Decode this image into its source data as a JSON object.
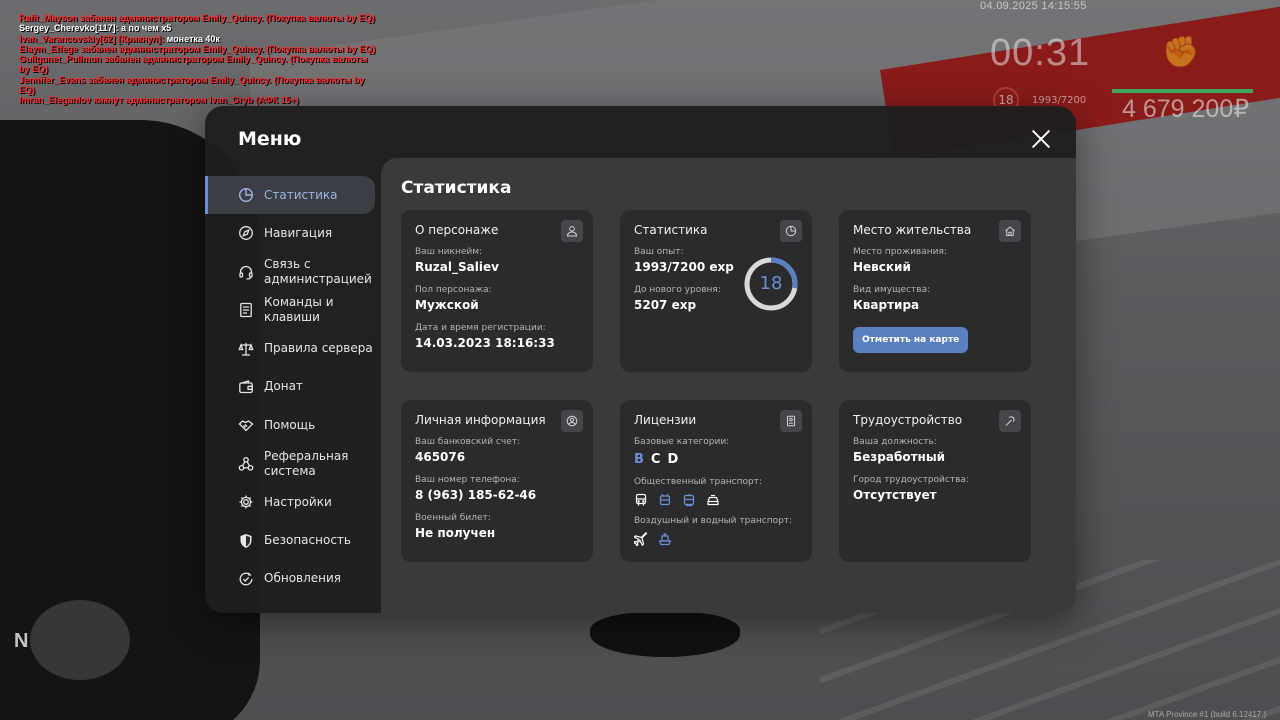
{
  "chat": [
    {
      "text": "Rafit_Mayson забанен администратором Emily_Quincy. (Покупка валюты by EQ)",
      "color": "red"
    },
    {
      "text": "Sergey_Cherevko[117]: а по чем x5",
      "color": "white"
    },
    {
      "text": "Ivan_Varancovskiy[62] [Крикнул]: монетка 40к",
      "color": "mixed"
    },
    {
      "text": "Elaym_Effege забанен администратором Emily_Quincy. (Покупка валюты by EQ)",
      "color": "red"
    },
    {
      "text": "Gullgunet_Pullmun забанен администратором Emily_Quincy. (Покупка валюты by EQ)",
      "color": "red"
    },
    {
      "text": "Jennifer_Evans забанен администратором Emily_Quincy. (Покупка валюты by EQ)",
      "color": "red"
    },
    {
      "text": "Imran_Eleganlov кикнут администратором Ivan_Gryb (АФК 15+)",
      "color": "red"
    }
  ],
  "hud": {
    "datetime": "04.09.2025 14:15:55",
    "timer": "00:31",
    "level": "18",
    "exp": "1993/7200",
    "money": "4 679 200₽",
    "compass": "N",
    "build": "MTA Province #1 (build 6.12417.)"
  },
  "menu": {
    "title": "Меню",
    "nav": [
      {
        "id": "stats",
        "label": "Статистика",
        "icon": "chart-pie-icon",
        "active": true
      },
      {
        "id": "nav",
        "label": "Навигация",
        "icon": "compass-icon",
        "active": false
      },
      {
        "id": "support",
        "label": "Связь с администрацией",
        "icon": "headset-icon",
        "active": false
      },
      {
        "id": "commands",
        "label": "Команды и клавиши",
        "icon": "document-icon",
        "active": false
      },
      {
        "id": "rules",
        "label": "Правила сервера",
        "icon": "scales-icon",
        "active": false
      },
      {
        "id": "donate",
        "label": "Донат",
        "icon": "wallet-icon",
        "active": false
      },
      {
        "id": "help",
        "label": "Помощь",
        "icon": "handshake-icon",
        "active": false
      },
      {
        "id": "referral",
        "label": "Реферальная система",
        "icon": "network-icon",
        "active": false
      },
      {
        "id": "settings",
        "label": "Настройки",
        "icon": "gear-icon",
        "active": false
      },
      {
        "id": "security",
        "label": "Безопасность",
        "icon": "shield-icon",
        "active": false
      },
      {
        "id": "updates",
        "label": "Обновления",
        "icon": "refresh-check-icon",
        "active": false
      }
    ]
  },
  "content": {
    "title": "Статистика",
    "character": {
      "title": "О персонаже",
      "nickname_label": "Ваш никнейм:",
      "nickname": "Ruzal_Saliev",
      "gender_label": "Пол персонажа:",
      "gender": "Мужской",
      "reg_label": "Дата и время регистрации:",
      "reg": "14.03.2023 18:16:33"
    },
    "stats": {
      "title": "Статистика",
      "exp_label": "Ваш опыт:",
      "exp": "1993/7200 exp",
      "next_label": "До нового уровня:",
      "next": "5207 exp",
      "level": "18",
      "progress": 0.2768
    },
    "residence": {
      "title": "Место жительства",
      "place_label": "Место проживания:",
      "place": "Невский",
      "property_label": "Вид имущества:",
      "property": "Квартира",
      "map_button": "Отметить на карте"
    },
    "personal": {
      "title": "Личная информация",
      "bank_label": "Ваш банковский счет:",
      "bank": "465076",
      "phone_label": "Ваш номер телефона:",
      "phone": "8 (963) 185-62-46",
      "military_label": "Военный билет:",
      "military": "Не получен"
    },
    "licenses": {
      "title": "Лицензии",
      "base_label": "Базовые категории:",
      "cat_b": "B",
      "cat_c": "C",
      "cat_d": "D",
      "public_label": "Общественный транспорт:",
      "air_label": "Воздушный и водный транспорт:"
    },
    "job": {
      "title": "Трудоустройство",
      "position_label": "Ваша должность:",
      "position": "Безработный",
      "city_label": "Город трудоустройства:",
      "city": "Отсутствует"
    }
  },
  "colors": {
    "accent": "#6b8fd6",
    "button": "#5a7fbf",
    "chat_red": "#ff2a2a"
  }
}
